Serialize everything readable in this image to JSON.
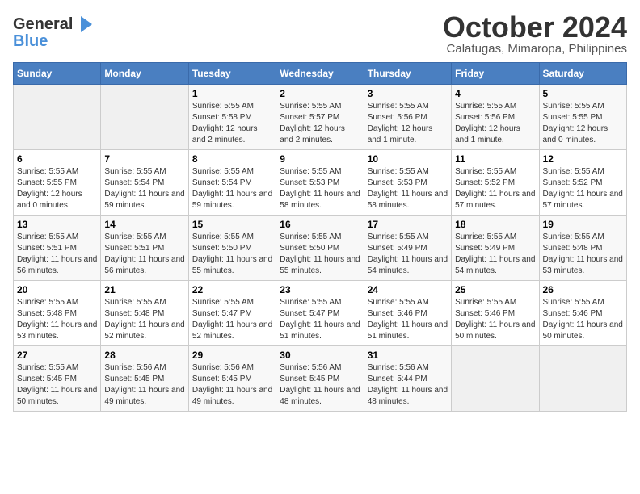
{
  "logo": {
    "line1": "General",
    "line2": "Blue",
    "icon": "▶"
  },
  "title": "October 2024",
  "subtitle": "Calatugas, Mimaropa, Philippines",
  "days_of_week": [
    "Sunday",
    "Monday",
    "Tuesday",
    "Wednesday",
    "Thursday",
    "Friday",
    "Saturday"
  ],
  "weeks": [
    [
      {
        "day": "",
        "sunrise": "",
        "sunset": "",
        "daylight": "",
        "empty": true
      },
      {
        "day": "",
        "sunrise": "",
        "sunset": "",
        "daylight": "",
        "empty": true
      },
      {
        "day": "1",
        "sunrise": "Sunrise: 5:55 AM",
        "sunset": "Sunset: 5:58 PM",
        "daylight": "Daylight: 12 hours and 2 minutes.",
        "empty": false
      },
      {
        "day": "2",
        "sunrise": "Sunrise: 5:55 AM",
        "sunset": "Sunset: 5:57 PM",
        "daylight": "Daylight: 12 hours and 2 minutes.",
        "empty": false
      },
      {
        "day": "3",
        "sunrise": "Sunrise: 5:55 AM",
        "sunset": "Sunset: 5:56 PM",
        "daylight": "Daylight: 12 hours and 1 minute.",
        "empty": false
      },
      {
        "day": "4",
        "sunrise": "Sunrise: 5:55 AM",
        "sunset": "Sunset: 5:56 PM",
        "daylight": "Daylight: 12 hours and 1 minute.",
        "empty": false
      },
      {
        "day": "5",
        "sunrise": "Sunrise: 5:55 AM",
        "sunset": "Sunset: 5:55 PM",
        "daylight": "Daylight: 12 hours and 0 minutes.",
        "empty": false
      }
    ],
    [
      {
        "day": "6",
        "sunrise": "Sunrise: 5:55 AM",
        "sunset": "Sunset: 5:55 PM",
        "daylight": "Daylight: 12 hours and 0 minutes.",
        "empty": false
      },
      {
        "day": "7",
        "sunrise": "Sunrise: 5:55 AM",
        "sunset": "Sunset: 5:54 PM",
        "daylight": "Daylight: 11 hours and 59 minutes.",
        "empty": false
      },
      {
        "day": "8",
        "sunrise": "Sunrise: 5:55 AM",
        "sunset": "Sunset: 5:54 PM",
        "daylight": "Daylight: 11 hours and 59 minutes.",
        "empty": false
      },
      {
        "day": "9",
        "sunrise": "Sunrise: 5:55 AM",
        "sunset": "Sunset: 5:53 PM",
        "daylight": "Daylight: 11 hours and 58 minutes.",
        "empty": false
      },
      {
        "day": "10",
        "sunrise": "Sunrise: 5:55 AM",
        "sunset": "Sunset: 5:53 PM",
        "daylight": "Daylight: 11 hours and 58 minutes.",
        "empty": false
      },
      {
        "day": "11",
        "sunrise": "Sunrise: 5:55 AM",
        "sunset": "Sunset: 5:52 PM",
        "daylight": "Daylight: 11 hours and 57 minutes.",
        "empty": false
      },
      {
        "day": "12",
        "sunrise": "Sunrise: 5:55 AM",
        "sunset": "Sunset: 5:52 PM",
        "daylight": "Daylight: 11 hours and 57 minutes.",
        "empty": false
      }
    ],
    [
      {
        "day": "13",
        "sunrise": "Sunrise: 5:55 AM",
        "sunset": "Sunset: 5:51 PM",
        "daylight": "Daylight: 11 hours and 56 minutes.",
        "empty": false
      },
      {
        "day": "14",
        "sunrise": "Sunrise: 5:55 AM",
        "sunset": "Sunset: 5:51 PM",
        "daylight": "Daylight: 11 hours and 56 minutes.",
        "empty": false
      },
      {
        "day": "15",
        "sunrise": "Sunrise: 5:55 AM",
        "sunset": "Sunset: 5:50 PM",
        "daylight": "Daylight: 11 hours and 55 minutes.",
        "empty": false
      },
      {
        "day": "16",
        "sunrise": "Sunrise: 5:55 AM",
        "sunset": "Sunset: 5:50 PM",
        "daylight": "Daylight: 11 hours and 55 minutes.",
        "empty": false
      },
      {
        "day": "17",
        "sunrise": "Sunrise: 5:55 AM",
        "sunset": "Sunset: 5:49 PM",
        "daylight": "Daylight: 11 hours and 54 minutes.",
        "empty": false
      },
      {
        "day": "18",
        "sunrise": "Sunrise: 5:55 AM",
        "sunset": "Sunset: 5:49 PM",
        "daylight": "Daylight: 11 hours and 54 minutes.",
        "empty": false
      },
      {
        "day": "19",
        "sunrise": "Sunrise: 5:55 AM",
        "sunset": "Sunset: 5:48 PM",
        "daylight": "Daylight: 11 hours and 53 minutes.",
        "empty": false
      }
    ],
    [
      {
        "day": "20",
        "sunrise": "Sunrise: 5:55 AM",
        "sunset": "Sunset: 5:48 PM",
        "daylight": "Daylight: 11 hours and 53 minutes.",
        "empty": false
      },
      {
        "day": "21",
        "sunrise": "Sunrise: 5:55 AM",
        "sunset": "Sunset: 5:48 PM",
        "daylight": "Daylight: 11 hours and 52 minutes.",
        "empty": false
      },
      {
        "day": "22",
        "sunrise": "Sunrise: 5:55 AM",
        "sunset": "Sunset: 5:47 PM",
        "daylight": "Daylight: 11 hours and 52 minutes.",
        "empty": false
      },
      {
        "day": "23",
        "sunrise": "Sunrise: 5:55 AM",
        "sunset": "Sunset: 5:47 PM",
        "daylight": "Daylight: 11 hours and 51 minutes.",
        "empty": false
      },
      {
        "day": "24",
        "sunrise": "Sunrise: 5:55 AM",
        "sunset": "Sunset: 5:46 PM",
        "daylight": "Daylight: 11 hours and 51 minutes.",
        "empty": false
      },
      {
        "day": "25",
        "sunrise": "Sunrise: 5:55 AM",
        "sunset": "Sunset: 5:46 PM",
        "daylight": "Daylight: 11 hours and 50 minutes.",
        "empty": false
      },
      {
        "day": "26",
        "sunrise": "Sunrise: 5:55 AM",
        "sunset": "Sunset: 5:46 PM",
        "daylight": "Daylight: 11 hours and 50 minutes.",
        "empty": false
      }
    ],
    [
      {
        "day": "27",
        "sunrise": "Sunrise: 5:55 AM",
        "sunset": "Sunset: 5:45 PM",
        "daylight": "Daylight: 11 hours and 50 minutes.",
        "empty": false
      },
      {
        "day": "28",
        "sunrise": "Sunrise: 5:56 AM",
        "sunset": "Sunset: 5:45 PM",
        "daylight": "Daylight: 11 hours and 49 minutes.",
        "empty": false
      },
      {
        "day": "29",
        "sunrise": "Sunrise: 5:56 AM",
        "sunset": "Sunset: 5:45 PM",
        "daylight": "Daylight: 11 hours and 49 minutes.",
        "empty": false
      },
      {
        "day": "30",
        "sunrise": "Sunrise: 5:56 AM",
        "sunset": "Sunset: 5:45 PM",
        "daylight": "Daylight: 11 hours and 48 minutes.",
        "empty": false
      },
      {
        "day": "31",
        "sunrise": "Sunrise: 5:56 AM",
        "sunset": "Sunset: 5:44 PM",
        "daylight": "Daylight: 11 hours and 48 minutes.",
        "empty": false
      },
      {
        "day": "",
        "sunrise": "",
        "sunset": "",
        "daylight": "",
        "empty": true
      },
      {
        "day": "",
        "sunrise": "",
        "sunset": "",
        "daylight": "",
        "empty": true
      }
    ]
  ]
}
